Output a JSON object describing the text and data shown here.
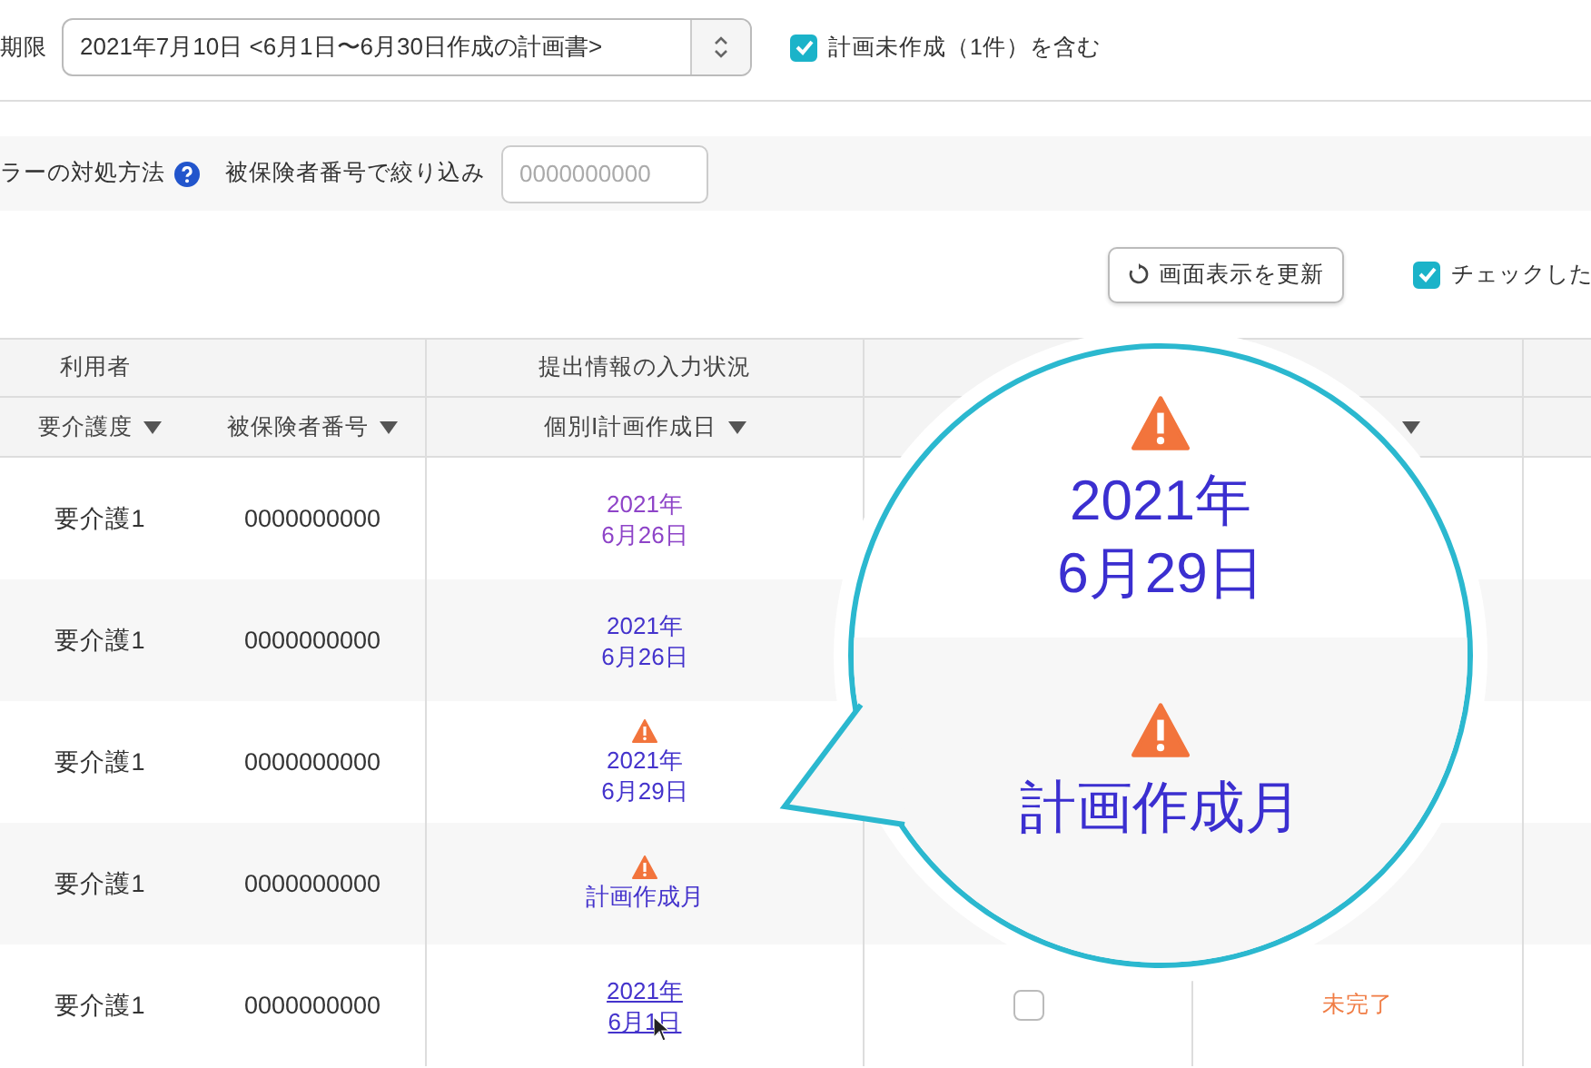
{
  "filter": {
    "label": "期限",
    "select_value": "2021年7月10日 <6月1日〜6月30日作成の計画書>",
    "include_unplanned": {
      "label": "計画未作成（1件）を含む",
      "checked": true
    }
  },
  "toolbar": {
    "error_help_label": "ラーの対処方法",
    "insured_filter": {
      "label": "被保険者番号で絞り込み",
      "placeholder": "0000000000"
    }
  },
  "actions": {
    "refresh_button": "画面表示を更新",
    "checked_option": {
      "label": "チェックした",
      "checked": true
    }
  },
  "table": {
    "group_headers": [
      "利用者",
      "提出情報の入力状況"
    ],
    "columns": [
      {
        "label": "要介護度",
        "sortable": true
      },
      {
        "label": "被保険者番号",
        "sortable": true
      },
      {
        "label": "個別Ⅰ計画作成日",
        "sortable": true
      },
      {
        "sortable": true
      }
    ],
    "rows": [
      {
        "care_level": "要介護1",
        "insured_number": "0000000000",
        "plan_date": "2021年\n6月26日",
        "warning": false,
        "visited": true,
        "hovered": false
      },
      {
        "care_level": "要介護1",
        "insured_number": "0000000000",
        "plan_date": "2021年\n6月26日",
        "warning": false,
        "visited": false,
        "hovered": false
      },
      {
        "care_level": "要介護1",
        "insured_number": "0000000000",
        "plan_date": "2021年\n6月29日",
        "warning": true,
        "visited": false,
        "hovered": false
      },
      {
        "care_level": "要介護1",
        "insured_number": "0000000000",
        "plan_date": "計画作成月",
        "warning": true,
        "visited": false,
        "hovered": false
      },
      {
        "care_level": "要介護1",
        "insured_number": "0000000000",
        "plan_date": "2021年\n6月1日",
        "warning": false,
        "visited": false,
        "hovered": true,
        "submitted": {
          "checked": false
        },
        "status": "未完了"
      }
    ]
  },
  "callout": {
    "items": [
      {
        "warning": true,
        "text": "2021年\n6月29日"
      },
      {
        "warning": true,
        "text": "計画作成月"
      }
    ]
  }
}
